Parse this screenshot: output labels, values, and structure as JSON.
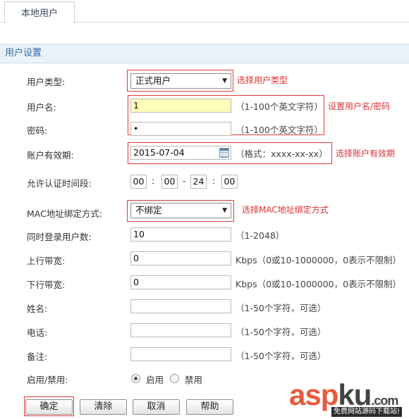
{
  "tab": {
    "label": "本地用户"
  },
  "section": {
    "title": "用户设置"
  },
  "fields": {
    "user_type": {
      "label": "用户类型:",
      "value": "正式用户",
      "annotation": "选择用户类型"
    },
    "username": {
      "label": "用户名:",
      "value": "1",
      "hint": "（1-100个英文字符）"
    },
    "password": {
      "label": "密码:",
      "value": "•",
      "hint": "（1-100个英文字符）"
    },
    "credentials_annotation": "设置用户名/密码",
    "expiry": {
      "label": "账户有效期:",
      "value": "2015-07-04",
      "hint": "（格式：xxxx-xx-xx）",
      "annotation": "选择账户有效期"
    },
    "auth_time": {
      "label": "允许认证时间段:",
      "start_hour": "00",
      "start_minute": "00",
      "end_hour": "24",
      "end_minute": "00",
      "colon": ":",
      "dash": "-"
    },
    "mac_binding": {
      "label": "MAC地址绑定方式:",
      "value": "不绑定",
      "annotation": "选择MAC地址绑定方式"
    },
    "concurrent": {
      "label": "同时登录用户数:",
      "value": "10",
      "hint": "（1-2048）"
    },
    "upstream": {
      "label": "上行带宽:",
      "value": "0",
      "hint": "Kbps（0或10-1000000，0表示不限制）"
    },
    "downstream": {
      "label": "下行带宽:",
      "value": "0",
      "hint": "Kbps（0或10-1000000，0表示不限制）"
    },
    "name": {
      "label": "姓名:",
      "value": "",
      "hint": "（1-50个字符，可选）"
    },
    "phone": {
      "label": "电话:",
      "value": "",
      "hint": "（1-50个字符，可选）"
    },
    "remark": {
      "label": "备注:",
      "value": "",
      "hint": "（1-50个字符，可选）"
    },
    "status": {
      "label": "启用/禁用:",
      "enable": "启用",
      "disable": "禁用",
      "selected": "enable"
    }
  },
  "buttons": {
    "confirm": "确定",
    "clear": "清除",
    "cancel": "取消",
    "help": "帮助"
  },
  "watermark": {
    "main_a": "asp",
    "main_b": "ku",
    "main_c": ".com",
    "sub": "免费网站源码下载站!"
  },
  "colors": {
    "annotation_red": "#e03030",
    "section_bg": "#eaf2f9",
    "section_text": "#2f6aa3",
    "highlight_yellow": "#ffffb9"
  }
}
